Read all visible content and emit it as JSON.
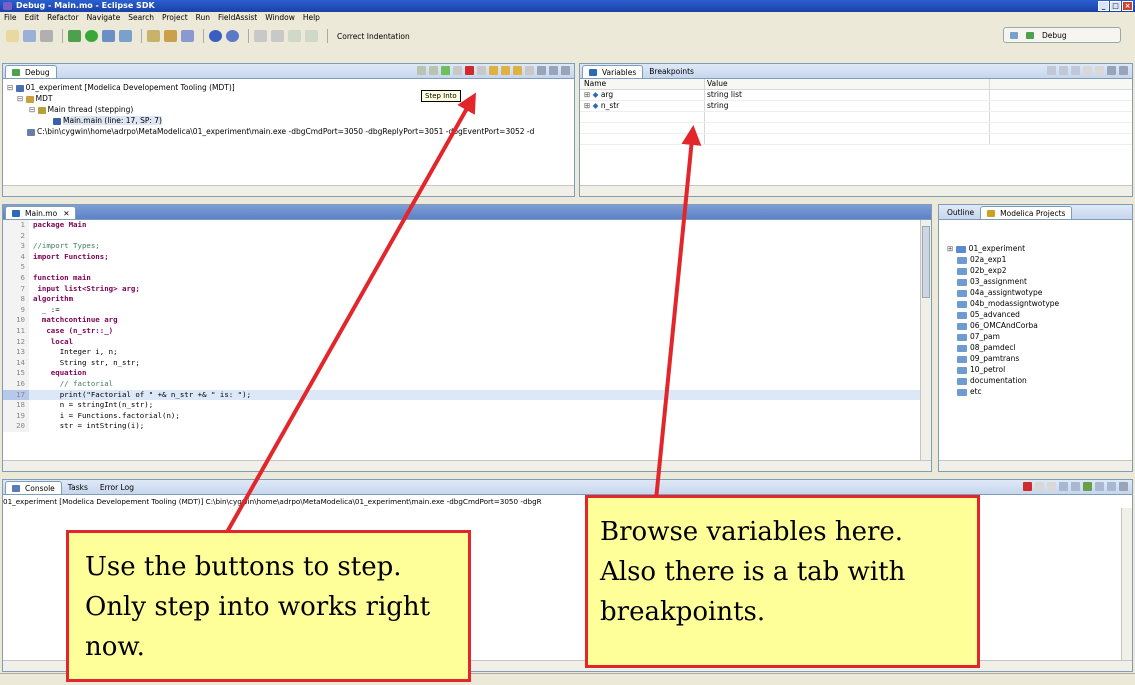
{
  "window": {
    "title": "Debug - Main.mo - Eclipse SDK"
  },
  "menu": [
    "File",
    "Edit",
    "Refactor",
    "Navigate",
    "Search",
    "Project",
    "Run",
    "FieldAssist",
    "Window",
    "Help"
  ],
  "toolbar": {
    "correct_indentation": "Correct Indentation"
  },
  "perspective": {
    "label": "Debug"
  },
  "debug_view": {
    "tab": "Debug",
    "tooltip": "Step Into",
    "tree": [
      "01_experiment [Modelica Developement Tooling (MDT)]",
      "MDT",
      "Main thread (stepping)",
      "Main.main (line: 17, SP: 7)",
      "C:\\bin\\cygwin\\home\\adrpo\\MetaModelica\\01_experiment\\main.exe -dbgCmdPort=3050 -dbgReplyPort=3051 -dbgEventPort=3052 -d"
    ]
  },
  "variables_view": {
    "tabs": [
      "Variables",
      "Breakpoints"
    ],
    "columns": [
      "Name",
      "Value"
    ],
    "rows": [
      {
        "name": "arg",
        "value": "string list"
      },
      {
        "name": "n_str",
        "value": "string"
      }
    ]
  },
  "editor": {
    "tab": "Main.mo",
    "lines": [
      {
        "n": "1",
        "t": "package Main"
      },
      {
        "n": "2",
        "t": ""
      },
      {
        "n": "3",
        "t": "//import Types;"
      },
      {
        "n": "4",
        "t": "import Functions;"
      },
      {
        "n": "5",
        "t": ""
      },
      {
        "n": "6",
        "t": "function main"
      },
      {
        "n": "7",
        "t": " input list<String> arg;"
      },
      {
        "n": "8",
        "t": "algorithm"
      },
      {
        "n": "9",
        "t": "  _ :="
      },
      {
        "n": "10",
        "t": "  matchcontinue arg"
      },
      {
        "n": "11",
        "t": "   case (n_str::_)"
      },
      {
        "n": "12",
        "t": "    local"
      },
      {
        "n": "13",
        "t": "      Integer i, n;"
      },
      {
        "n": "14",
        "t": "      String str, n_str;"
      },
      {
        "n": "15",
        "t": "    equation"
      },
      {
        "n": "16",
        "t": "      // factorial"
      },
      {
        "n": "17",
        "t": "      print(\"Factorial of \" +& n_str +& \" is: \");"
      },
      {
        "n": "18",
        "t": "      n = stringInt(n_str);"
      },
      {
        "n": "19",
        "t": "      i = Functions.factorial(n);"
      },
      {
        "n": "20",
        "t": "      str = intString(i);"
      }
    ]
  },
  "outline_tabs": [
    "Outline",
    "Modelica Projects"
  ],
  "projects": [
    "01_experiment",
    "02a_exp1",
    "02b_exp2",
    "03_assignment",
    "04a_assigntwotype",
    "04b_modassigntwotype",
    "05_advanced",
    "06_OMCAndCorba",
    "07_pam",
    "08_pamdecl",
    "09_pamtrans",
    "10_petrol",
    "documentation",
    "etc"
  ],
  "console": {
    "tabs": [
      "Console",
      "Tasks",
      "Error Log"
    ],
    "line": "01_experiment [Modelica Developement Tooling (MDT)] C:\\bin\\cygwin\\home\\adrpo\\MetaModelica\\01_experiment\\main.exe -dbgCmdPort=3050 -dbgR"
  },
  "callouts": {
    "step": "Use the buttons to step. Only step into works right now.",
    "browse": "Browse variables here. Also there is a tab with breakpoints."
  },
  "colors": {
    "arrow": "#e3262b",
    "callout_bg": "#ffff99",
    "title_blue": "#1941a5"
  }
}
